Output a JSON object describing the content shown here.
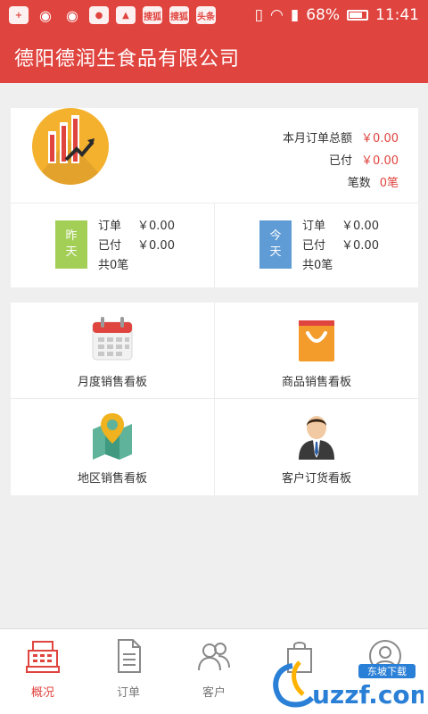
{
  "status_bar": {
    "icons": [
      "plus-icon",
      "weibo-icon",
      "weibo-icon",
      "app-icon",
      "upload-icon",
      "sougou-icon",
      "sougou-icon",
      "news-icon",
      "vibrate-icon",
      "wifi-icon",
      "sim-icon",
      "battery-icon"
    ],
    "badge_sougou": "搜狐",
    "badge_news": "头条",
    "battery": "68%",
    "time": "11:41"
  },
  "app_bar": {
    "title": "德阳德润生食品有限公司"
  },
  "summary": {
    "month_total_label": "本月订单总额",
    "month_total_value": "￥0.00",
    "paid_label": "已付",
    "paid_value": "￥0.00",
    "count_label": "笔数",
    "count_value": "0笔",
    "yesterday": {
      "badge_line1": "昨",
      "badge_line2": "天",
      "order_label": "订单",
      "order_value": "￥0.00",
      "paid_label": "已付",
      "paid_value": "￥0.00",
      "total_count": "共0笔"
    },
    "today": {
      "badge_line1": "今",
      "badge_line2": "天",
      "order_label": "订单",
      "order_value": "￥0.00",
      "paid_label": "已付",
      "paid_value": "￥0.00",
      "total_count": "共0笔"
    }
  },
  "boards": [
    {
      "label": "月度销售看板",
      "icon": "calendar-icon"
    },
    {
      "label": "商品销售看板",
      "icon": "shopping-bag-icon"
    },
    {
      "label": "地区销售看板",
      "icon": "map-icon"
    },
    {
      "label": "客户订货看板",
      "icon": "customer-icon"
    }
  ],
  "bottom_nav": [
    {
      "label": "概况",
      "icon": "cash-register-icon",
      "active": true
    },
    {
      "label": "订单",
      "icon": "document-icon"
    },
    {
      "label": "客户",
      "icon": "users-icon"
    },
    {
      "label": "",
      "icon": "bag-icon"
    },
    {
      "label": "",
      "icon": "profile-icon"
    }
  ],
  "watermark": {
    "text": "uzzf.com",
    "badge": "东坡下载"
  },
  "colors": {
    "accent": "#e0443f",
    "yesterday_badge": "#a3cf57",
    "today_badge": "#5f9bd5",
    "logo_bg": "#f3b12e"
  }
}
